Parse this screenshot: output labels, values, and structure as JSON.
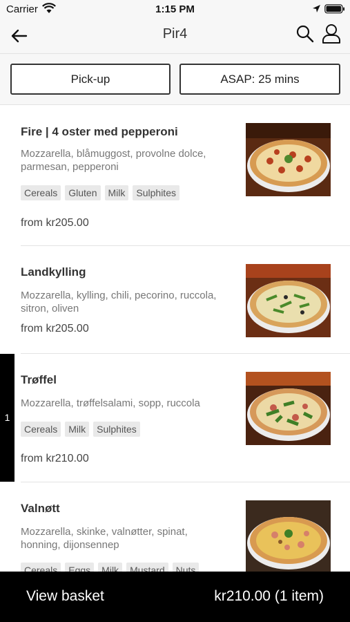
{
  "status_bar": {
    "carrier": "Carrier",
    "time": "1:15 PM"
  },
  "nav": {
    "title": "Pir4"
  },
  "options": {
    "mode": "Pick-up",
    "timing": "ASAP: 25 mins"
  },
  "menu": {
    "items": [
      {
        "name": "Fire | 4 oster med pepperoni",
        "description": "Mozzarella, blåmuggost, provolne dolce, parmesan, pepperoni",
        "allergens": [
          "Cereals",
          "Gluten",
          "Milk",
          "Sulphites"
        ],
        "price": "from kr205.00"
      },
      {
        "name": "Landkylling",
        "description": "Mozzarella, kylling, chili, pecorino, ruccola, sitron, oliven",
        "allergens": [],
        "price": "from kr205.00"
      },
      {
        "name": "Trøffel",
        "description": "Mozzarella, trøffelsalami, sopp, ruccola",
        "allergens": [
          "Cereals",
          "Milk",
          "Sulphites"
        ],
        "price": "from kr210.00",
        "in_basket": "1"
      },
      {
        "name": "Valnøtt",
        "description": "Mozzarella, skinke, valnøtter, spinat, honning, dijonsennep",
        "allergens": [
          "Cereals",
          "Eggs",
          "Milk",
          "Mustard",
          "Nuts"
        ],
        "price": ""
      }
    ]
  },
  "basket": {
    "label": "View basket",
    "total": "kr210.00 (1 item)"
  },
  "colors": {
    "basket_bar": "#000000",
    "tag_bg": "#e9e9e9",
    "header_bg": "#f7f7f7"
  }
}
